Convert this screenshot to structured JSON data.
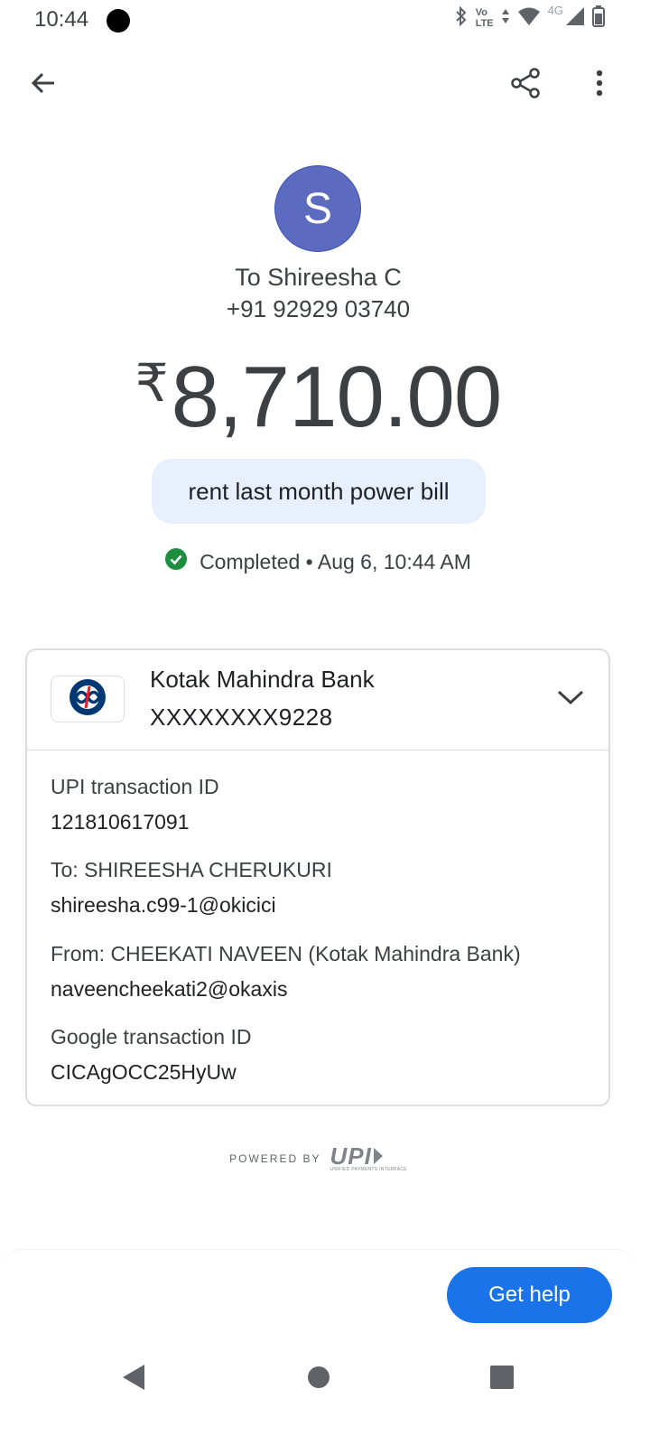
{
  "status_bar": {
    "time": "10:44",
    "volte_top": "Vo",
    "volte_bottom": "LTE",
    "network": "4G"
  },
  "toolbar": {
    "back_icon": "arrow-back-icon",
    "share_icon": "share-icon",
    "more_icon": "more-vert-icon"
  },
  "payee": {
    "avatar_letter": "S",
    "name": "To Shireesha C",
    "phone": "+91 92929 03740"
  },
  "payment": {
    "currency_symbol": "₹",
    "amount": "8,710.00",
    "note": "rent last month power bill",
    "status": "Completed • Aug 6, 10:44 AM",
    "status_color": "#1e8e3e"
  },
  "bank_card": {
    "bank_name": "Kotak Mahindra Bank",
    "account": "XXXXXXXX9228",
    "details": [
      {
        "label": "UPI transaction ID",
        "value": "121810617091"
      },
      {
        "label": "To: SHIREESHA CHERUKURI",
        "value": "shireesha.c99-1@okicici"
      },
      {
        "label": "From: CHEEKATI  NAVEEN (Kotak Mahindra Bank)",
        "value": "naveencheekati2@okaxis"
      },
      {
        "label": "Google transaction ID",
        "value": "CICAgOCC25HyUw"
      }
    ]
  },
  "footer": {
    "powered_by": "POWERED BY",
    "upi_logo": "UPI",
    "upi_subtitle": "UNIFIED PAYMENTS INTERFACE"
  },
  "help_button": "Get help",
  "accent_color": "#1a73e8"
}
